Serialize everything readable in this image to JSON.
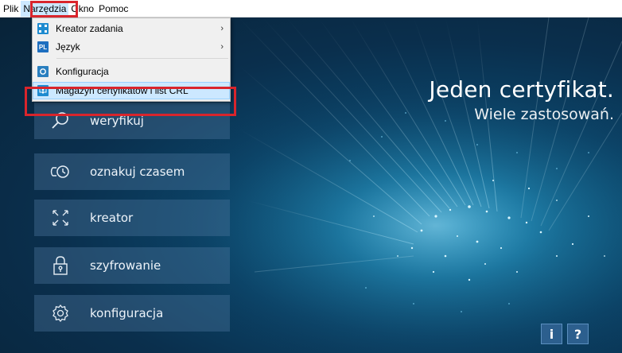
{
  "menubar": {
    "items": [
      {
        "label": "Plik"
      },
      {
        "label": "Narzędzia"
      },
      {
        "label": "Okno"
      },
      {
        "label": "Pomoc"
      }
    ]
  },
  "dropdown": {
    "items": [
      {
        "label": "Kreator zadania",
        "icon": "wizard-icon",
        "has_submenu": true
      },
      {
        "label": "Język",
        "icon": "language-pl-icon",
        "icon_text": "PL",
        "has_submenu": true
      },
      {
        "label": "Konfiguracja",
        "icon": "settings-icon",
        "has_submenu": false
      },
      {
        "label": "Magazyn certyfikatów i list CRL",
        "icon": "certificate-store-icon",
        "has_submenu": false,
        "highlighted": true
      }
    ]
  },
  "hero": {
    "title": "Jeden certyfikat.",
    "subtitle": "Wiele zastosowań."
  },
  "actions": [
    {
      "label": "weryfikuj",
      "icon": "magnifier-icon"
    },
    {
      "label": "oznakuj czasem",
      "icon": "timestamp-icon"
    },
    {
      "label": "kreator",
      "icon": "expand-arrows-icon"
    },
    {
      "label": "szyfrowanie",
      "icon": "padlock-icon"
    },
    {
      "label": "konfiguracja",
      "icon": "gear-icon"
    }
  ],
  "corner_buttons": {
    "info": "i",
    "help": "?"
  },
  "colors": {
    "highlight_border": "#d9252c",
    "menu_hover": "#cce8ff",
    "background_dark": "#0a2f4d"
  }
}
